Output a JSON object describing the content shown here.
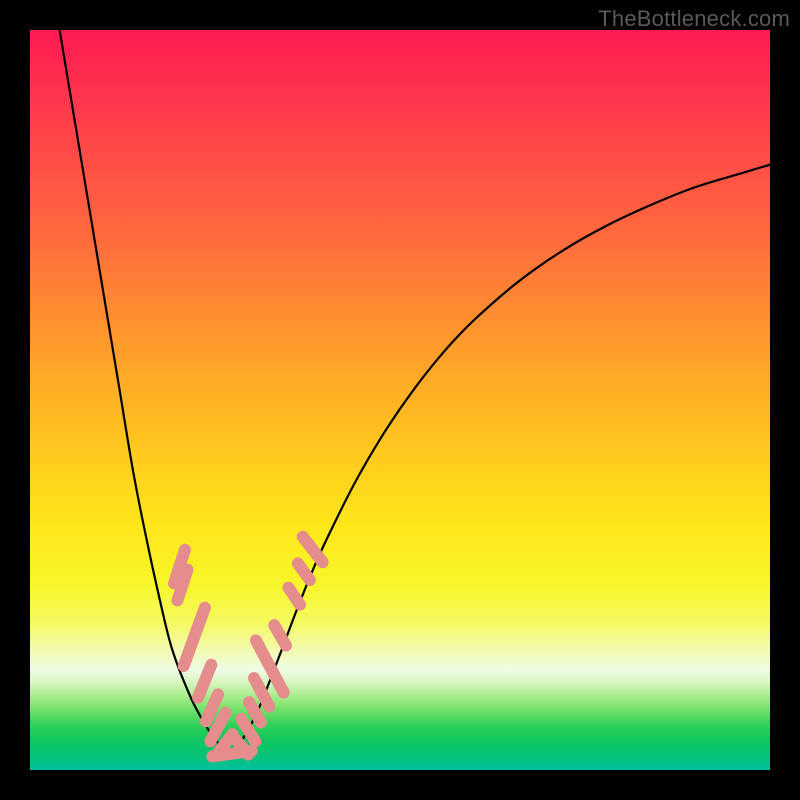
{
  "watermark": "TheBottleneck.com",
  "colors": {
    "curve": "#000000",
    "marker_fill": "#e58c8c",
    "marker_stroke": "#e58c8c"
  },
  "chart_data": {
    "type": "line",
    "title": "",
    "xlabel": "",
    "ylabel": "",
    "xlim": [
      0,
      100
    ],
    "ylim": [
      0,
      100
    ],
    "series": [
      {
        "name": "bottleneck-curve-left",
        "x": [
          4,
          6,
          8,
          10,
          12,
          14,
          16,
          18,
          19,
          20,
          21,
          22,
          23,
          24,
          25,
          26,
          27
        ],
        "y": [
          100,
          88,
          76,
          64,
          52,
          40,
          30,
          21,
          17,
          14,
          11.5,
          9.2,
          7.3,
          5.6,
          4.2,
          3,
          2.1
        ]
      },
      {
        "name": "bottleneck-curve-right",
        "x": [
          27,
          28,
          29,
          30,
          31,
          32,
          34,
          36,
          38,
          40,
          44,
          48,
          52,
          56,
          60,
          66,
          72,
          78,
          84,
          90,
          96,
          100
        ],
        "y": [
          2.1,
          3.1,
          4.6,
          6.4,
          8.5,
          11,
          16.2,
          21.5,
          26.5,
          31,
          39,
          45.8,
          51.6,
          56.6,
          60.8,
          66,
          70.2,
          73.6,
          76.4,
          78.8,
          80.6,
          81.8
        ]
      }
    ],
    "markers": {
      "name": "highlighted-points",
      "shape": "capsule",
      "points": [
        {
          "x": 20.2,
          "y": 27.5,
          "len": 3.2,
          "ang": -72
        },
        {
          "x": 20.6,
          "y": 25.0,
          "len": 3.0,
          "ang": -72
        },
        {
          "x": 22.2,
          "y": 18.0,
          "len": 5.0,
          "ang": -70
        },
        {
          "x": 23.6,
          "y": 12.0,
          "len": 3.2,
          "ang": -68
        },
        {
          "x": 24.6,
          "y": 8.4,
          "len": 2.8,
          "ang": -66
        },
        {
          "x": 25.4,
          "y": 5.8,
          "len": 3.0,
          "ang": -62
        },
        {
          "x": 26.4,
          "y": 3.6,
          "len": 2.4,
          "ang": -52
        },
        {
          "x": 27.3,
          "y": 2.2,
          "len": 3.5,
          "ang": -8
        },
        {
          "x": 28.5,
          "y": 3.3,
          "len": 2.4,
          "ang": 50
        },
        {
          "x": 29.5,
          "y": 5.4,
          "len": 2.6,
          "ang": 58
        },
        {
          "x": 30.4,
          "y": 7.8,
          "len": 2.4,
          "ang": 60
        },
        {
          "x": 31.3,
          "y": 10.5,
          "len": 3.0,
          "ang": 62
        },
        {
          "x": 32.4,
          "y": 14.0,
          "len": 4.8,
          "ang": 62
        },
        {
          "x": 33.8,
          "y": 18.2,
          "len": 2.4,
          "ang": 60
        },
        {
          "x": 35.7,
          "y": 23.5,
          "len": 2.2,
          "ang": 56
        },
        {
          "x": 37.0,
          "y": 26.8,
          "len": 2.2,
          "ang": 54
        },
        {
          "x": 38.2,
          "y": 29.8,
          "len": 3.0,
          "ang": 52
        }
      ]
    }
  }
}
